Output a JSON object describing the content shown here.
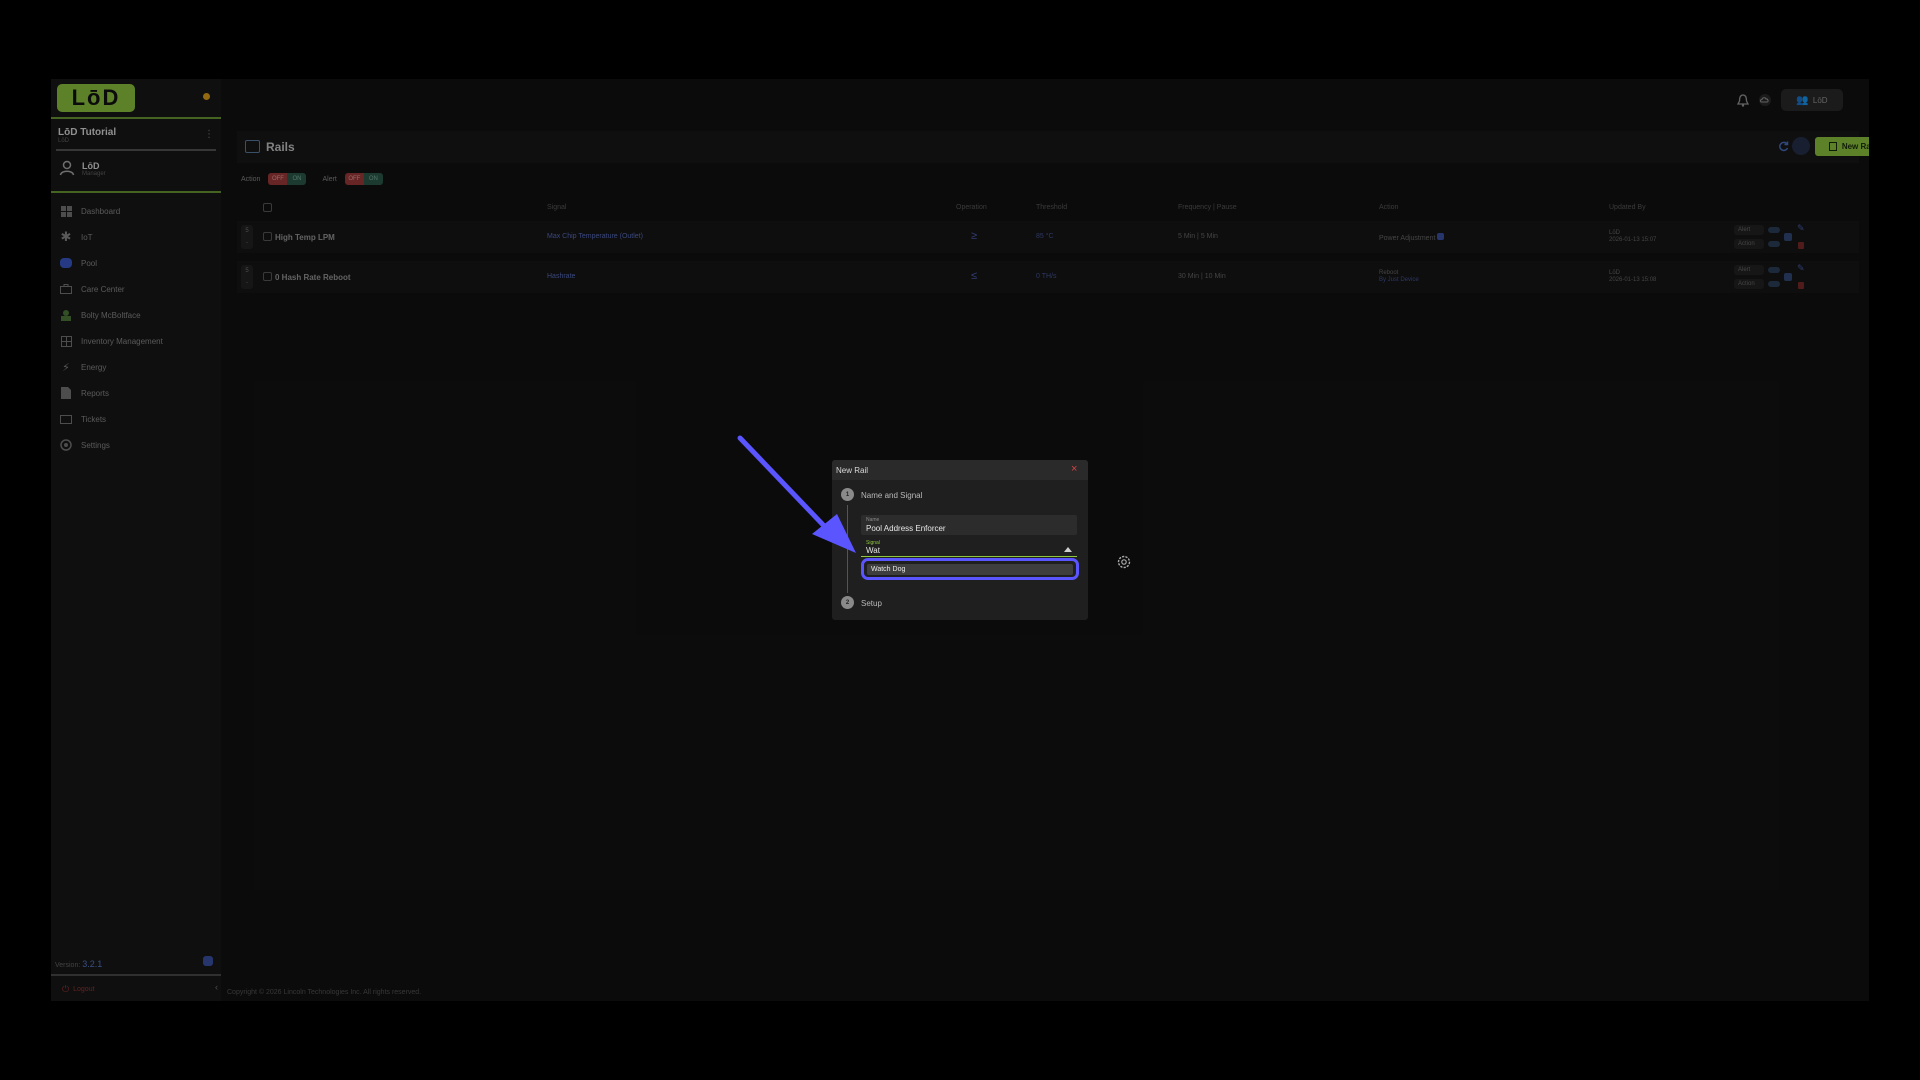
{
  "sidebar": {
    "logo": "LōD",
    "org_name": "LōD Tutorial",
    "org_sub": "LōD",
    "user_name": "LōD",
    "user_role": "Manager",
    "items": [
      {
        "label": "Dashboard",
        "icon": "dashboard-icon"
      },
      {
        "label": "IoT",
        "icon": "asterisk-icon"
      },
      {
        "label": "Pool",
        "icon": "pool-icon"
      },
      {
        "label": "Care Center",
        "icon": "briefcase-icon"
      },
      {
        "label": "Bolty McBoltface",
        "icon": "bolty-icon"
      },
      {
        "label": "Inventory Management",
        "icon": "inventory-icon"
      },
      {
        "label": "Energy",
        "icon": "lightning-icon"
      },
      {
        "label": "Reports",
        "icon": "document-icon"
      },
      {
        "label": "Tickets",
        "icon": "ticket-icon"
      },
      {
        "label": "Settings",
        "icon": "gear-icon"
      }
    ],
    "version_label": "Version:",
    "version_value": "3.2.1",
    "logout": "Logout"
  },
  "topbar": {
    "user_pill": "LōD"
  },
  "rails": {
    "title": "Rails",
    "new_rail": "New Rail",
    "filters": {
      "action_label": "Action",
      "alert_label": "Alert",
      "off": "OFF",
      "on": "ON"
    },
    "columns": [
      "Signal",
      "Operation",
      "Threshold",
      "Frequency | Pause",
      "Action",
      "Updated By"
    ],
    "rows": [
      {
        "badge": "5",
        "name": "High Temp LPM",
        "signal": "Max Chip Temperature (Outlet)",
        "operation": "≥",
        "threshold": "85 °C",
        "frequency": "5 Min | 5 Min",
        "action": "Power Adjustment",
        "action_sub": "",
        "updated_user": "LōD",
        "updated_date": "2026-01-13 15:07",
        "alert_label": "Alert",
        "action_label": "Action"
      },
      {
        "badge": "5",
        "name": "0 Hash Rate Reboot",
        "signal": "Hashrate",
        "operation": "≤",
        "threshold": "0 TH/s",
        "frequency": "30 Min | 10 Min",
        "action": "Reboot",
        "action_sub": "By Just Device",
        "updated_user": "LōD",
        "updated_date": "2026-01-13 15:08",
        "alert_label": "Alert",
        "action_label": "Action"
      }
    ]
  },
  "copyright": "Copyright © 2026 Lincoln Technologies Inc. All rights reserved.",
  "modal": {
    "title": "New Rail",
    "step1_label": "Name and Signal",
    "step1_number": "1",
    "step2_label": "Setup",
    "step2_number": "2",
    "name_field_label": "Name",
    "name_field_value": "Pool Address Enforcer",
    "signal_field_label": "Signal",
    "signal_field_value": "Wat",
    "option": "Watch Dog"
  },
  "colors": {
    "brand_green": "#8ec63f",
    "highlight": "#5a55ff",
    "link_blue": "#5a6fc0",
    "danger": "#d24444"
  }
}
